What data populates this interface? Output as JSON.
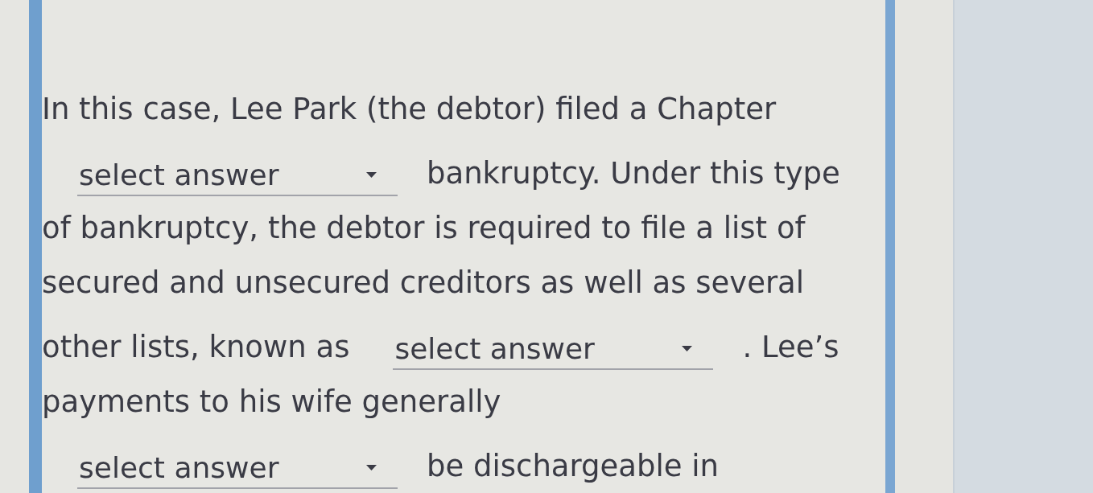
{
  "question": {
    "lines": [
      [
        {
          "kind": "text",
          "text": "In this case, Lee Park (the debtor) filed a Chapter"
        }
      ],
      [
        {
          "kind": "dropdown",
          "placeholder": "select answer"
        },
        {
          "kind": "text",
          "text": "bankruptcy. Under this type"
        }
      ],
      [
        {
          "kind": "text",
          "text": "of bankruptcy, the debtor is required to file a list of"
        }
      ],
      [
        {
          "kind": "text",
          "text": "secured and unsecured creditors as well as several"
        }
      ],
      [
        {
          "kind": "text",
          "text": "other lists, known as"
        },
        {
          "kind": "dropdown",
          "placeholder": "select answer"
        },
        {
          "kind": "text",
          "text": ". Lee’s"
        }
      ],
      [
        {
          "kind": "text",
          "text": "payments to his wife generally"
        }
      ],
      [
        {
          "kind": "dropdown",
          "placeholder": "select answer"
        },
        {
          "kind": "text",
          "text": "be dischargeable in"
        }
      ]
    ]
  }
}
